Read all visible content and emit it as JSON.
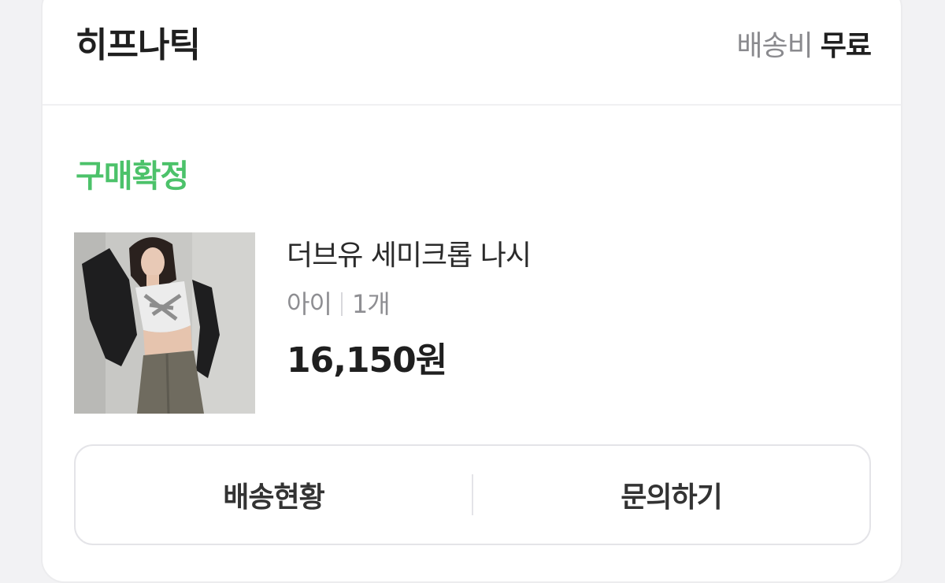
{
  "order_card": {
    "shop_name": "히프나틱",
    "shipping_label": "배송비",
    "shipping_value": "무료",
    "status": "구매확정",
    "product": {
      "name": "더브유 세미크롭 나시",
      "option": "아이",
      "quantity": "1개",
      "price": "16,150원"
    },
    "actions": {
      "delivery_status": "배송현황",
      "inquiry": "문의하기"
    }
  },
  "colors": {
    "status_green": "#4cc26a",
    "text_dark": "#1f1f1f",
    "text_gray": "#8a8a8e",
    "border": "#e4e4e8"
  }
}
